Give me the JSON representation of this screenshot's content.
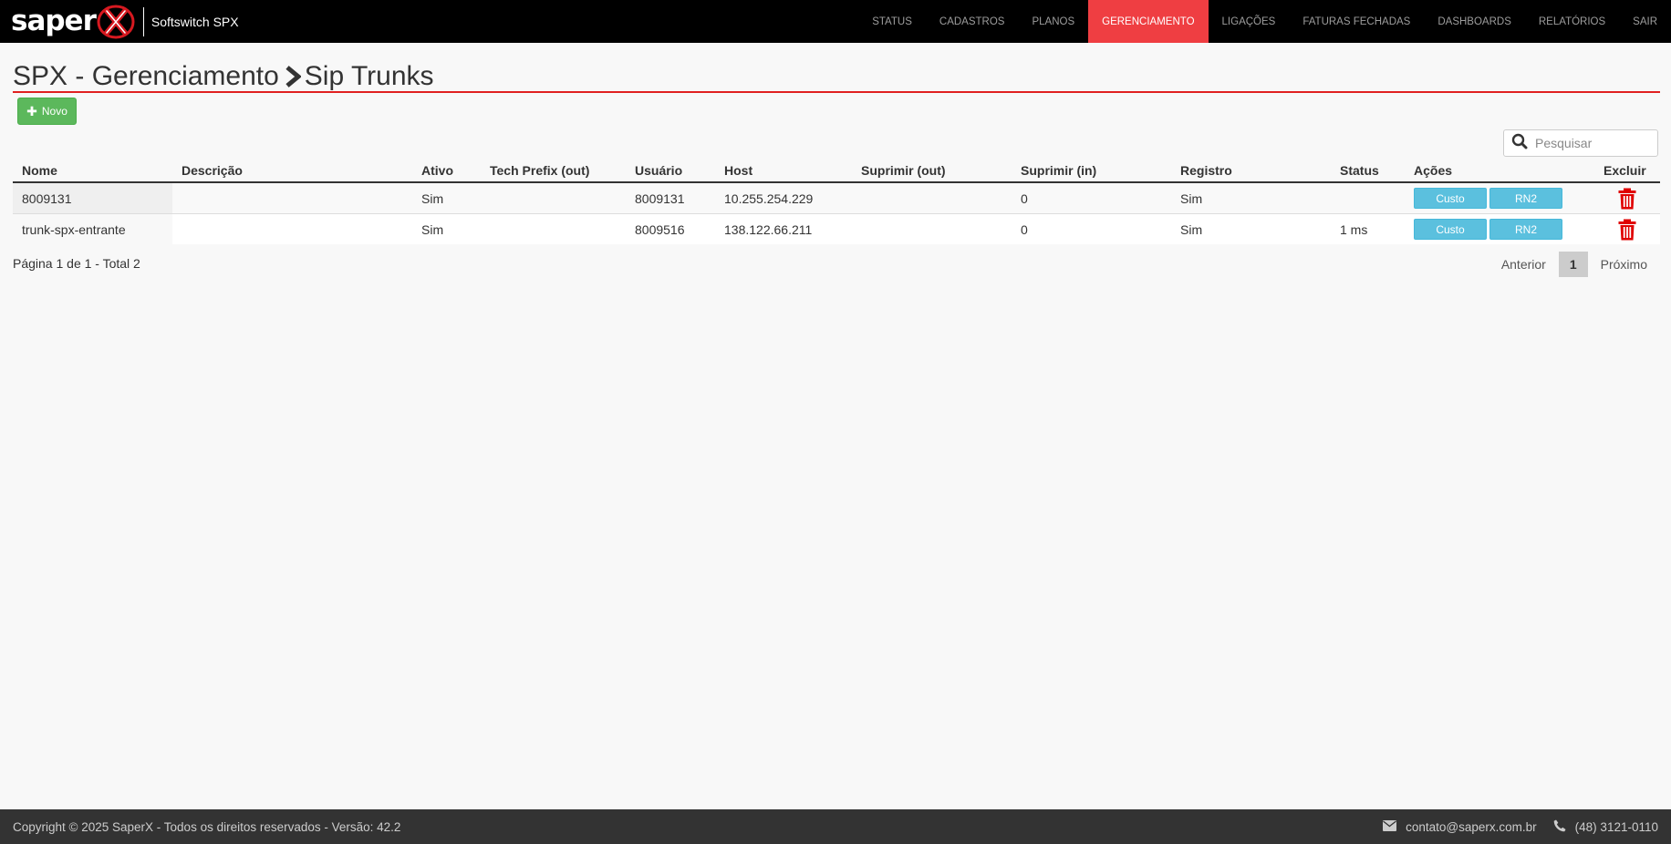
{
  "brand": {
    "logo_text": "saper",
    "title": "Softswitch SPX"
  },
  "nav": {
    "items": [
      {
        "label": "STATUS"
      },
      {
        "label": "CADASTROS"
      },
      {
        "label": "PLANOS"
      },
      {
        "label": "GERENCIAMENTO",
        "active": true
      },
      {
        "label": "LIGAÇÕES"
      },
      {
        "label": "FATURAS FECHADAS"
      },
      {
        "label": "DASHBOARDS"
      },
      {
        "label": "RELATÓRIOS"
      },
      {
        "label": "SAIR"
      }
    ],
    "active_color": "#ef3e42"
  },
  "page": {
    "breadcrumb_root": "SPX - Gerenciamento",
    "breadcrumb_current": "Sip Trunks",
    "new_button": "Novo"
  },
  "search": {
    "placeholder": "Pesquisar",
    "value": ""
  },
  "table": {
    "columns": [
      "Nome",
      "Descrição",
      "Ativo",
      "Tech Prefix (out)",
      "Usuário",
      "Host",
      "Suprimir (out)",
      "Suprimir (in)",
      "Registro",
      "Status",
      "Ações",
      "Excluir"
    ],
    "rows": [
      {
        "nome": "8009131",
        "descricao": "",
        "ativo": "Sim",
        "tech_prefix": "",
        "usuario": "8009131",
        "host": "10.255.254.229",
        "suprimir_out": "",
        "suprimir_in": "0",
        "registro": "Sim",
        "status": "",
        "btn_custo": "Custo",
        "btn_rn2": "RN2"
      },
      {
        "nome": "trunk-spx-entrante",
        "descricao": "",
        "ativo": "Sim",
        "tech_prefix": "",
        "usuario": "8009516",
        "host": "138.122.66.211",
        "suprimir_out": "",
        "suprimir_in": "0",
        "registro": "Sim",
        "status": "1 ms",
        "btn_custo": "Custo",
        "btn_rn2": "RN2"
      }
    ]
  },
  "pagination": {
    "info": "Página 1 de 1 - Total 2",
    "prev": "Anterior",
    "current": "1",
    "next": "Próximo"
  },
  "footer": {
    "copyright": "Copyright © 2025 SaperX - Todos os direitos reservados - Versão: 42.2",
    "email": "contato@saperx.com.br",
    "phone": "(48) 3121-0110"
  },
  "colors": {
    "new_button": "#5cb85c",
    "action_button": "#5bc0de",
    "trash": "#e00000",
    "title_rule": "#e02020"
  },
  "icons": [
    "saperx-logo",
    "chevron-right-icon",
    "plus-icon",
    "search-icon",
    "trash-icon",
    "envelope-icon",
    "phone-icon"
  ]
}
